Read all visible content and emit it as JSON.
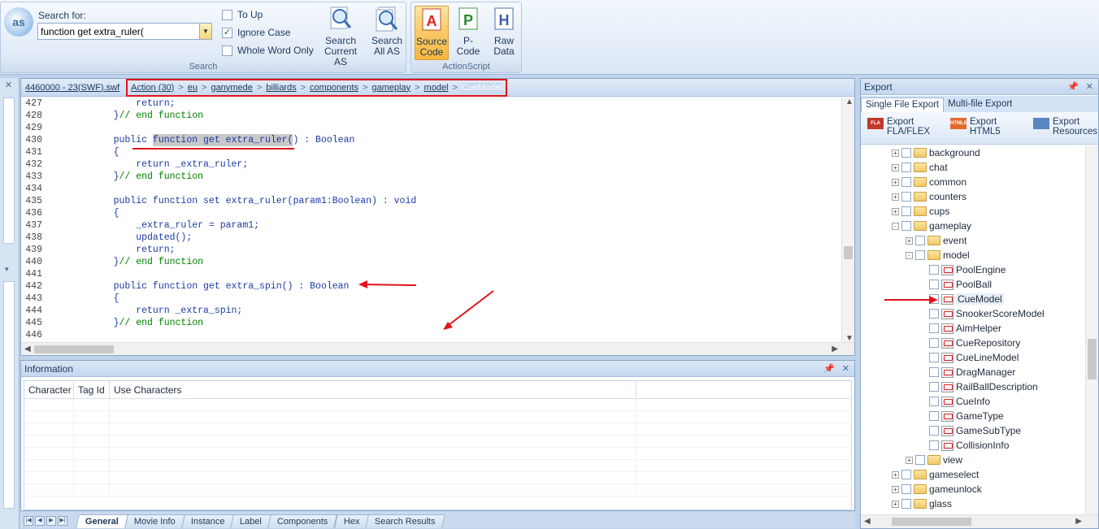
{
  "ribbon": {
    "search_label": "Search for:",
    "search_value": "function get extra_ruler(",
    "options": {
      "to_up": "To Up",
      "ignore_case": "Ignore Case",
      "whole_word": "Whole Word Only"
    },
    "search_current": [
      "Search",
      "Current AS"
    ],
    "search_all": [
      "Search",
      "All AS"
    ],
    "group_search": "Search",
    "source_code": [
      "Source",
      "Code"
    ],
    "pcode": "P-Code",
    "raw_data": [
      "Raw",
      "Data"
    ],
    "group_actionscript": "ActionScript",
    "logo_text": "as",
    "icon_a": "A",
    "icon_p": "P",
    "icon_h": "H"
  },
  "editor": {
    "file": "4460000 - 23(SWF).swf",
    "crumbs": [
      "Action (30)",
      "eu",
      "ganymede",
      "billiards",
      "components",
      "gameplay",
      "model",
      "CueModel"
    ],
    "lines": [
      {
        "n": "427",
        "parts": [
          {
            "t": "        return;",
            "c": "kw"
          }
        ]
      },
      {
        "n": "428",
        "parts": [
          {
            "t": "    }",
            "c": "kw"
          },
          {
            "t": "// end function",
            "c": "cm"
          }
        ]
      },
      {
        "n": "429",
        "parts": []
      },
      {
        "n": "430",
        "parts": [
          {
            "t": "    public ",
            "c": "kw"
          },
          {
            "t": "function get extra_ruler(",
            "c": "hl"
          },
          {
            "t": ") : Boolean",
            "c": "kw"
          }
        ]
      },
      {
        "n": "431",
        "parts": [
          {
            "t": "    {",
            "c": "kw"
          }
        ]
      },
      {
        "n": "432",
        "parts": [
          {
            "t": "        return _extra_ruler;",
            "c": "kw"
          }
        ]
      },
      {
        "n": "433",
        "parts": [
          {
            "t": "    }",
            "c": "kw"
          },
          {
            "t": "// end function",
            "c": "cm"
          }
        ]
      },
      {
        "n": "434",
        "parts": []
      },
      {
        "n": "435",
        "parts": [
          {
            "t": "    public function set extra_ruler(param1:Boolean) : void",
            "c": "kw"
          }
        ]
      },
      {
        "n": "436",
        "parts": [
          {
            "t": "    {",
            "c": "kw"
          }
        ]
      },
      {
        "n": "437",
        "parts": [
          {
            "t": "        _extra_ruler = param1;",
            "c": "kw"
          }
        ]
      },
      {
        "n": "438",
        "parts": [
          {
            "t": "        updated();",
            "c": "kw"
          }
        ]
      },
      {
        "n": "439",
        "parts": [
          {
            "t": "        return;",
            "c": "kw"
          }
        ]
      },
      {
        "n": "440",
        "parts": [
          {
            "t": "    }",
            "c": "kw"
          },
          {
            "t": "// end function",
            "c": "cm"
          }
        ]
      },
      {
        "n": "441",
        "parts": []
      },
      {
        "n": "442",
        "parts": [
          {
            "t": "    public function get extra_spin() : Boolean",
            "c": "kw"
          }
        ]
      },
      {
        "n": "443",
        "parts": [
          {
            "t": "    {",
            "c": "kw"
          }
        ]
      },
      {
        "n": "444",
        "parts": [
          {
            "t": "        return _extra_spin;",
            "c": "kw"
          }
        ]
      },
      {
        "n": "445",
        "parts": [
          {
            "t": "    }",
            "c": "kw"
          },
          {
            "t": "// end function",
            "c": "cm"
          }
        ]
      },
      {
        "n": "446",
        "parts": []
      }
    ]
  },
  "info": {
    "title": "Information",
    "columns": [
      "Character",
      "Tag Id",
      "Use Characters",
      ""
    ]
  },
  "tabs": [
    "General",
    "Movie Info",
    "Instance",
    "Label",
    "Components",
    "Hex",
    "Search Results"
  ],
  "export": {
    "title": "Export",
    "tab_single": "Single File Export",
    "tab_multi": "Multi-file Export",
    "btn_fla": [
      "Export",
      "FLA/FLEX"
    ],
    "btn_html5": [
      "Export",
      "HTML5"
    ],
    "btn_res": [
      "Export",
      "Resources"
    ],
    "icon_fla": "FLA",
    "icon_html5": "HTML5",
    "tree": [
      {
        "label": "background",
        "lvl": 0,
        "kind": "folder",
        "exp": "+"
      },
      {
        "label": "chat",
        "lvl": 0,
        "kind": "folder",
        "exp": "+"
      },
      {
        "label": "common",
        "lvl": 0,
        "kind": "folder",
        "exp": "+"
      },
      {
        "label": "counters",
        "lvl": 0,
        "kind": "folder",
        "exp": "+"
      },
      {
        "label": "cups",
        "lvl": 0,
        "kind": "folder",
        "exp": "+"
      },
      {
        "label": "gameplay",
        "lvl": 0,
        "kind": "folder",
        "exp": "-"
      },
      {
        "label": "event",
        "lvl": 1,
        "kind": "folder",
        "exp": "+"
      },
      {
        "label": "model",
        "lvl": 1,
        "kind": "folder",
        "exp": "-"
      },
      {
        "label": "PoolEngine",
        "lvl": 2,
        "kind": "as"
      },
      {
        "label": "PoolBall",
        "lvl": 2,
        "kind": "as"
      },
      {
        "label": "CueModel",
        "lvl": 2,
        "kind": "as",
        "selected": true
      },
      {
        "label": "SnookerScoreModel",
        "lvl": 2,
        "kind": "as"
      },
      {
        "label": "AimHelper",
        "lvl": 2,
        "kind": "as"
      },
      {
        "label": "CueRepository",
        "lvl": 2,
        "kind": "as"
      },
      {
        "label": "CueLineModel",
        "lvl": 2,
        "kind": "as"
      },
      {
        "label": "DragManager",
        "lvl": 2,
        "kind": "as"
      },
      {
        "label": "RailBallDescription",
        "lvl": 2,
        "kind": "as"
      },
      {
        "label": "CueInfo",
        "lvl": 2,
        "kind": "as"
      },
      {
        "label": "GameType",
        "lvl": 2,
        "kind": "as"
      },
      {
        "label": "GameSubType",
        "lvl": 2,
        "kind": "as"
      },
      {
        "label": "CollisionInfo",
        "lvl": 2,
        "kind": "as"
      },
      {
        "label": "view",
        "lvl": 1,
        "kind": "folder",
        "exp": "+"
      },
      {
        "label": "gameselect",
        "lvl": 0,
        "kind": "folder",
        "exp": "+"
      },
      {
        "label": "gameunlock",
        "lvl": 0,
        "kind": "folder",
        "exp": "+"
      },
      {
        "label": "glass",
        "lvl": 0,
        "kind": "folder",
        "exp": "+"
      }
    ]
  },
  "colors": {
    "accent": "#1c3ba4",
    "comment": "#008000",
    "annotation": "#e0141b",
    "selection": "#c8c8c8"
  },
  "icons": [
    "search-icon",
    "close-icon",
    "pin-icon",
    "folder-icon",
    "actionscript-file-icon"
  ]
}
